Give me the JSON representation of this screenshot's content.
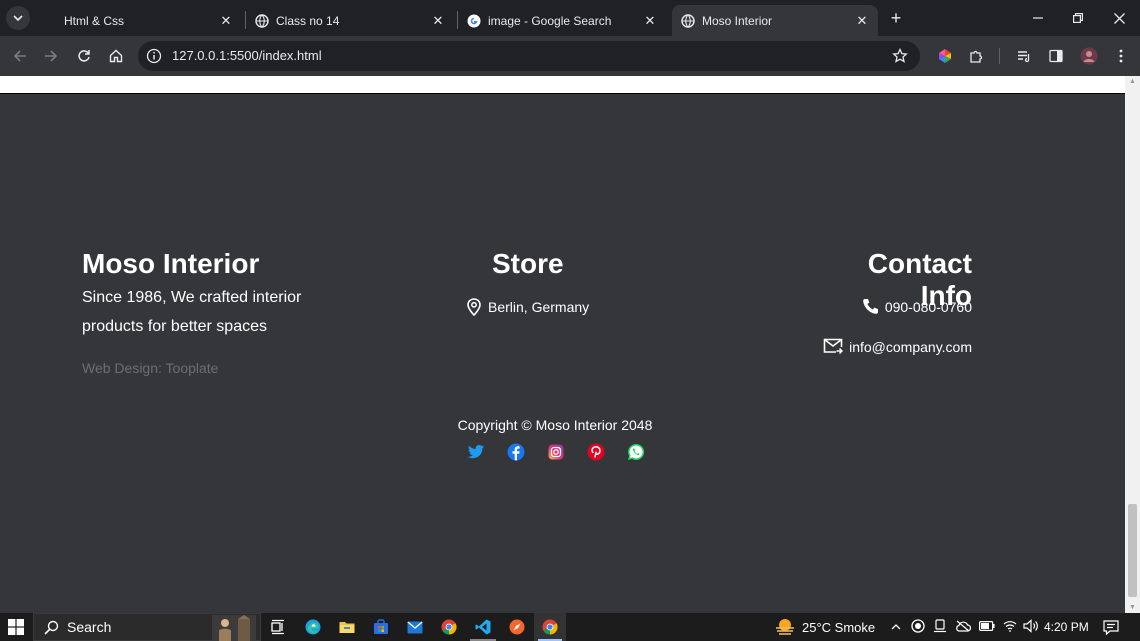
{
  "browser": {
    "tabs": [
      {
        "title": "Html & Css",
        "favicon": "blank"
      },
      {
        "title": "Class no 14",
        "favicon": "globe-icon"
      },
      {
        "title": "image - Google Search",
        "favicon": "google-icon"
      },
      {
        "title": "Moso Interior",
        "favicon": "globe-icon",
        "active": true
      }
    ],
    "url": "127.0.0.1:5500/index.html"
  },
  "footer": {
    "brand": {
      "title": "Moso Interior",
      "tagline": "Since 1986, We crafted interior products for better spaces",
      "credit": "Web Design: Tooplate"
    },
    "store": {
      "title": "Store",
      "location": "Berlin, Germany"
    },
    "contact": {
      "title": "Contact Info",
      "phone": "090-080-0760",
      "email": "info@company.com"
    },
    "copyright": "Copyright © Moso Interior 2048",
    "socials": [
      "twitter-icon",
      "facebook-icon",
      "instagram-icon",
      "pinterest-icon",
      "whatsapp-icon"
    ]
  },
  "taskbar": {
    "search_label": "Search",
    "weather": "25°C  Smoke",
    "time": "4:20 PM"
  },
  "colors": {
    "footer_bg": "#35363a",
    "chrome_frame": "#202124",
    "credit_text": "#6c6e75"
  }
}
